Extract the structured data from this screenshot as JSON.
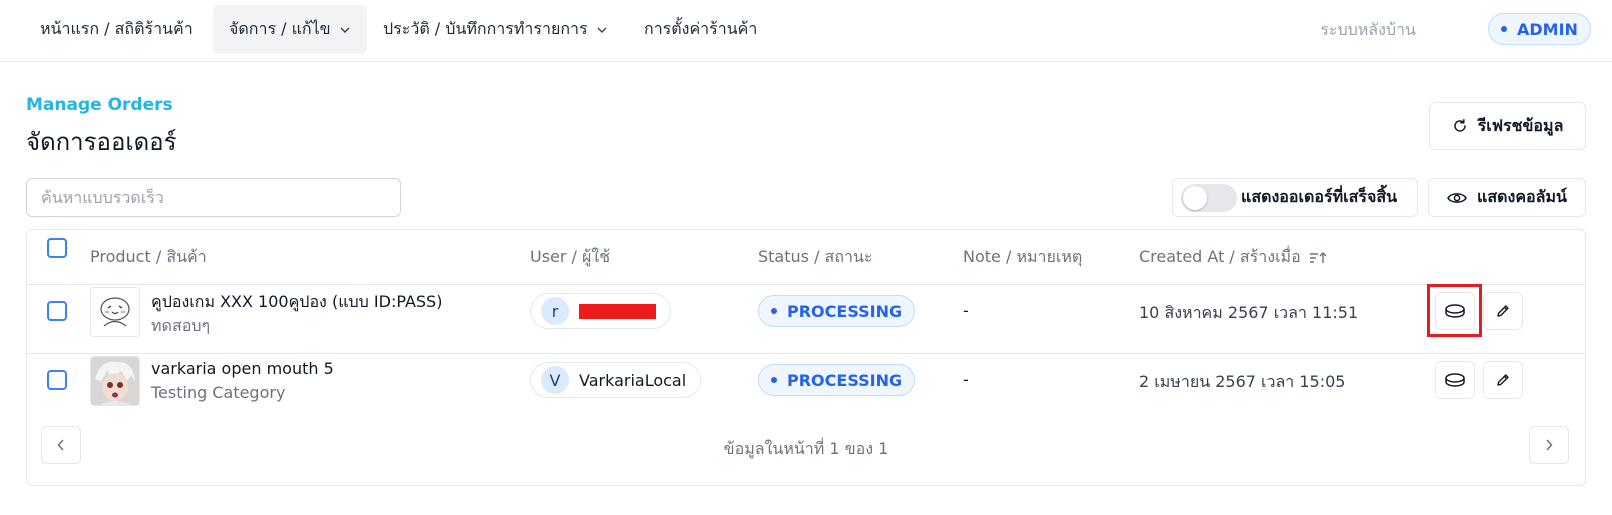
{
  "nav": {
    "items": [
      {
        "label": "หน้าแรก / สถิติร้านค้า",
        "dropdown": false,
        "active": false
      },
      {
        "label": "จัดการ / แก้ไข",
        "dropdown": true,
        "active": true
      },
      {
        "label": "ประวัติ / บันทึกการทำรายการ",
        "dropdown": true,
        "active": false
      },
      {
        "label": "การตั้งค่าร้านค้า",
        "dropdown": false,
        "active": false
      }
    ],
    "backend_label": "ระบบหลังบ้าน",
    "role_badge": "ADMIN"
  },
  "page": {
    "subtitle": "Manage Orders",
    "title": "จัดการออเดอร์",
    "refresh_label": "รีเฟรชข้อมูล"
  },
  "toolbar": {
    "search_placeholder": "ค้นหาแบบรวดเร็ว",
    "show_completed_label": "แสดงออเดอร์ที่เสร็จสิ้น",
    "show_completed_on": false,
    "show_columns_label": "แสดงคอลัมน์"
  },
  "table": {
    "columns": {
      "product": "Product / สินค้า",
      "user": "User / ผู้ใช้",
      "status": "Status / สถานะ",
      "note": "Note / หมายเหตุ",
      "created": "Created At / สร้างเมื่อ"
    },
    "rows": [
      {
        "product_name": "คูปองเกม XXX 100คูปอง (แบบ ID:PASS)",
        "category": "ทดสอบๆ",
        "user_initial": "r",
        "user_name": "",
        "user_redacted": true,
        "status": "PROCESSING",
        "note": "-",
        "created_at": "10 สิงหาคม 2567 เวลา 11:51",
        "thumb": "coupon-mascot-thumbnail",
        "highlighted_action": true
      },
      {
        "product_name": "varkaria open mouth 5",
        "category": "Testing Category",
        "user_initial": "V",
        "user_name": "VarkariaLocal",
        "user_redacted": false,
        "status": "PROCESSING",
        "note": "-",
        "created_at": "2 เมษายน 2567 เวลา 15:05",
        "thumb": "character-photo-thumbnail",
        "highlighted_action": false
      }
    ]
  },
  "pagination": {
    "summary": "ข้อมูลในหน้าที่ 1 ของ 1"
  },
  "colors": {
    "accent": "#22b7e3",
    "status_blue": "#2563eb",
    "highlight_red": "#e11d22"
  }
}
